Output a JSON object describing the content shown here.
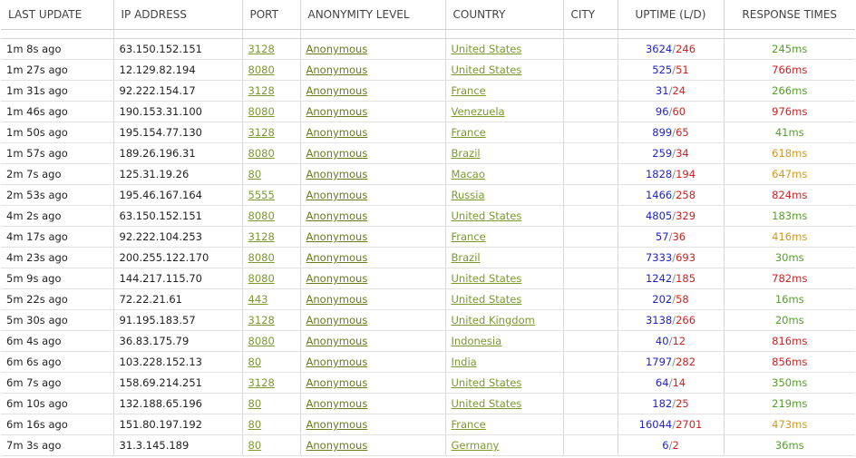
{
  "headers": {
    "last_update": "LAST UPDATE",
    "ip_address": "IP ADDRESS",
    "port": "PORT",
    "anonymity": "ANONYMITY LEVEL",
    "country": "COUNTRY",
    "city": "CITY",
    "uptime": "UPTIME (L/D)",
    "response": "RESPONSE TIMES"
  },
  "colors": {
    "link_green": "#7a9a2e",
    "uptime_up": "#2222cc",
    "uptime_down": "#cc2222",
    "resp_fast": "#55a02a",
    "resp_medium": "#d09820",
    "resp_slow": "#cc2222"
  },
  "rows": [
    {
      "last_update": "1m 8s ago",
      "ip": "63.150.152.151",
      "port": "3128",
      "anonymity": "Anonymous",
      "country": "United States",
      "city": "",
      "up": "3624",
      "down": "246",
      "response": "245ms",
      "speed": "fast"
    },
    {
      "last_update": "1m 27s ago",
      "ip": "12.129.82.194",
      "port": "8080",
      "anonymity": "Anonymous",
      "country": "United States",
      "city": "",
      "up": "525",
      "down": "51",
      "response": "766ms",
      "speed": "slow"
    },
    {
      "last_update": "1m 31s ago",
      "ip": "92.222.154.17",
      "port": "3128",
      "anonymity": "Anonymous",
      "country": "France",
      "city": "",
      "up": "31",
      "down": "24",
      "response": "266ms",
      "speed": "fast"
    },
    {
      "last_update": "1m 46s ago",
      "ip": "190.153.31.100",
      "port": "8080",
      "anonymity": "Anonymous",
      "country": "Venezuela",
      "city": "",
      "up": "96",
      "down": "60",
      "response": "976ms",
      "speed": "slow"
    },
    {
      "last_update": "1m 50s ago",
      "ip": "195.154.77.130",
      "port": "3128",
      "anonymity": "Anonymous",
      "country": "France",
      "city": "",
      "up": "899",
      "down": "65",
      "response": "41ms",
      "speed": "fast"
    },
    {
      "last_update": "1m 57s ago",
      "ip": "189.26.196.31",
      "port": "8080",
      "anonymity": "Anonymous",
      "country": "Brazil",
      "city": "",
      "up": "259",
      "down": "34",
      "response": "618ms",
      "speed": "medium"
    },
    {
      "last_update": "2m 7s ago",
      "ip": "125.31.19.26",
      "port": "80",
      "anonymity": "Anonymous",
      "country": "Macao",
      "city": "",
      "up": "1828",
      "down": "194",
      "response": "647ms",
      "speed": "medium"
    },
    {
      "last_update": "2m 53s ago",
      "ip": "195.46.167.164",
      "port": "5555",
      "anonymity": "Anonymous",
      "country": "Russia",
      "city": "",
      "up": "1466",
      "down": "258",
      "response": "824ms",
      "speed": "slow"
    },
    {
      "last_update": "4m 2s ago",
      "ip": "63.150.152.151",
      "port": "8080",
      "anonymity": "Anonymous",
      "country": "United States",
      "city": "",
      "up": "4805",
      "down": "329",
      "response": "183ms",
      "speed": "fast"
    },
    {
      "last_update": "4m 17s ago",
      "ip": "92.222.104.253",
      "port": "3128",
      "anonymity": "Anonymous",
      "country": "France",
      "city": "",
      "up": "57",
      "down": "36",
      "response": "416ms",
      "speed": "medium"
    },
    {
      "last_update": "4m 23s ago",
      "ip": "200.255.122.170",
      "port": "8080",
      "anonymity": "Anonymous",
      "country": "Brazil",
      "city": "",
      "up": "7333",
      "down": "693",
      "response": "30ms",
      "speed": "fast"
    },
    {
      "last_update": "5m 9s ago",
      "ip": "144.217.115.70",
      "port": "8080",
      "anonymity": "Anonymous",
      "country": "United States",
      "city": "",
      "up": "1242",
      "down": "185",
      "response": "782ms",
      "speed": "slow"
    },
    {
      "last_update": "5m 22s ago",
      "ip": "72.22.21.61",
      "port": "443",
      "anonymity": "Anonymous",
      "country": "United States",
      "city": "",
      "up": "202",
      "down": "58",
      "response": "16ms",
      "speed": "fast"
    },
    {
      "last_update": "5m 30s ago",
      "ip": "91.195.183.57",
      "port": "3128",
      "anonymity": "Anonymous",
      "country": "United Kingdom",
      "city": "",
      "up": "3138",
      "down": "266",
      "response": "20ms",
      "speed": "fast"
    },
    {
      "last_update": "6m 4s ago",
      "ip": "36.83.175.79",
      "port": "8080",
      "anonymity": "Anonymous",
      "country": "Indonesia",
      "city": "",
      "up": "40",
      "down": "12",
      "response": "816ms",
      "speed": "slow"
    },
    {
      "last_update": "6m 6s ago",
      "ip": "103.228.152.13",
      "port": "80",
      "anonymity": "Anonymous",
      "country": "India",
      "city": "",
      "up": "1797",
      "down": "282",
      "response": "856ms",
      "speed": "slow"
    },
    {
      "last_update": "6m 7s ago",
      "ip": "158.69.214.251",
      "port": "3128",
      "anonymity": "Anonymous",
      "country": "United States",
      "city": "",
      "up": "64",
      "down": "14",
      "response": "350ms",
      "speed": "fast"
    },
    {
      "last_update": "6m 10s ago",
      "ip": "132.188.65.196",
      "port": "80",
      "anonymity": "Anonymous",
      "country": "United States",
      "city": "",
      "up": "182",
      "down": "25",
      "response": "219ms",
      "speed": "fast"
    },
    {
      "last_update": "6m 16s ago",
      "ip": "151.80.197.192",
      "port": "80",
      "anonymity": "Anonymous",
      "country": "France",
      "city": "",
      "up": "16044",
      "down": "2701",
      "response": "473ms",
      "speed": "medium"
    },
    {
      "last_update": "7m 3s ago",
      "ip": "31.3.145.189",
      "port": "80",
      "anonymity": "Anonymous",
      "country": "Germany",
      "city": "",
      "up": "6",
      "down": "2",
      "response": "36ms",
      "speed": "fast"
    }
  ]
}
